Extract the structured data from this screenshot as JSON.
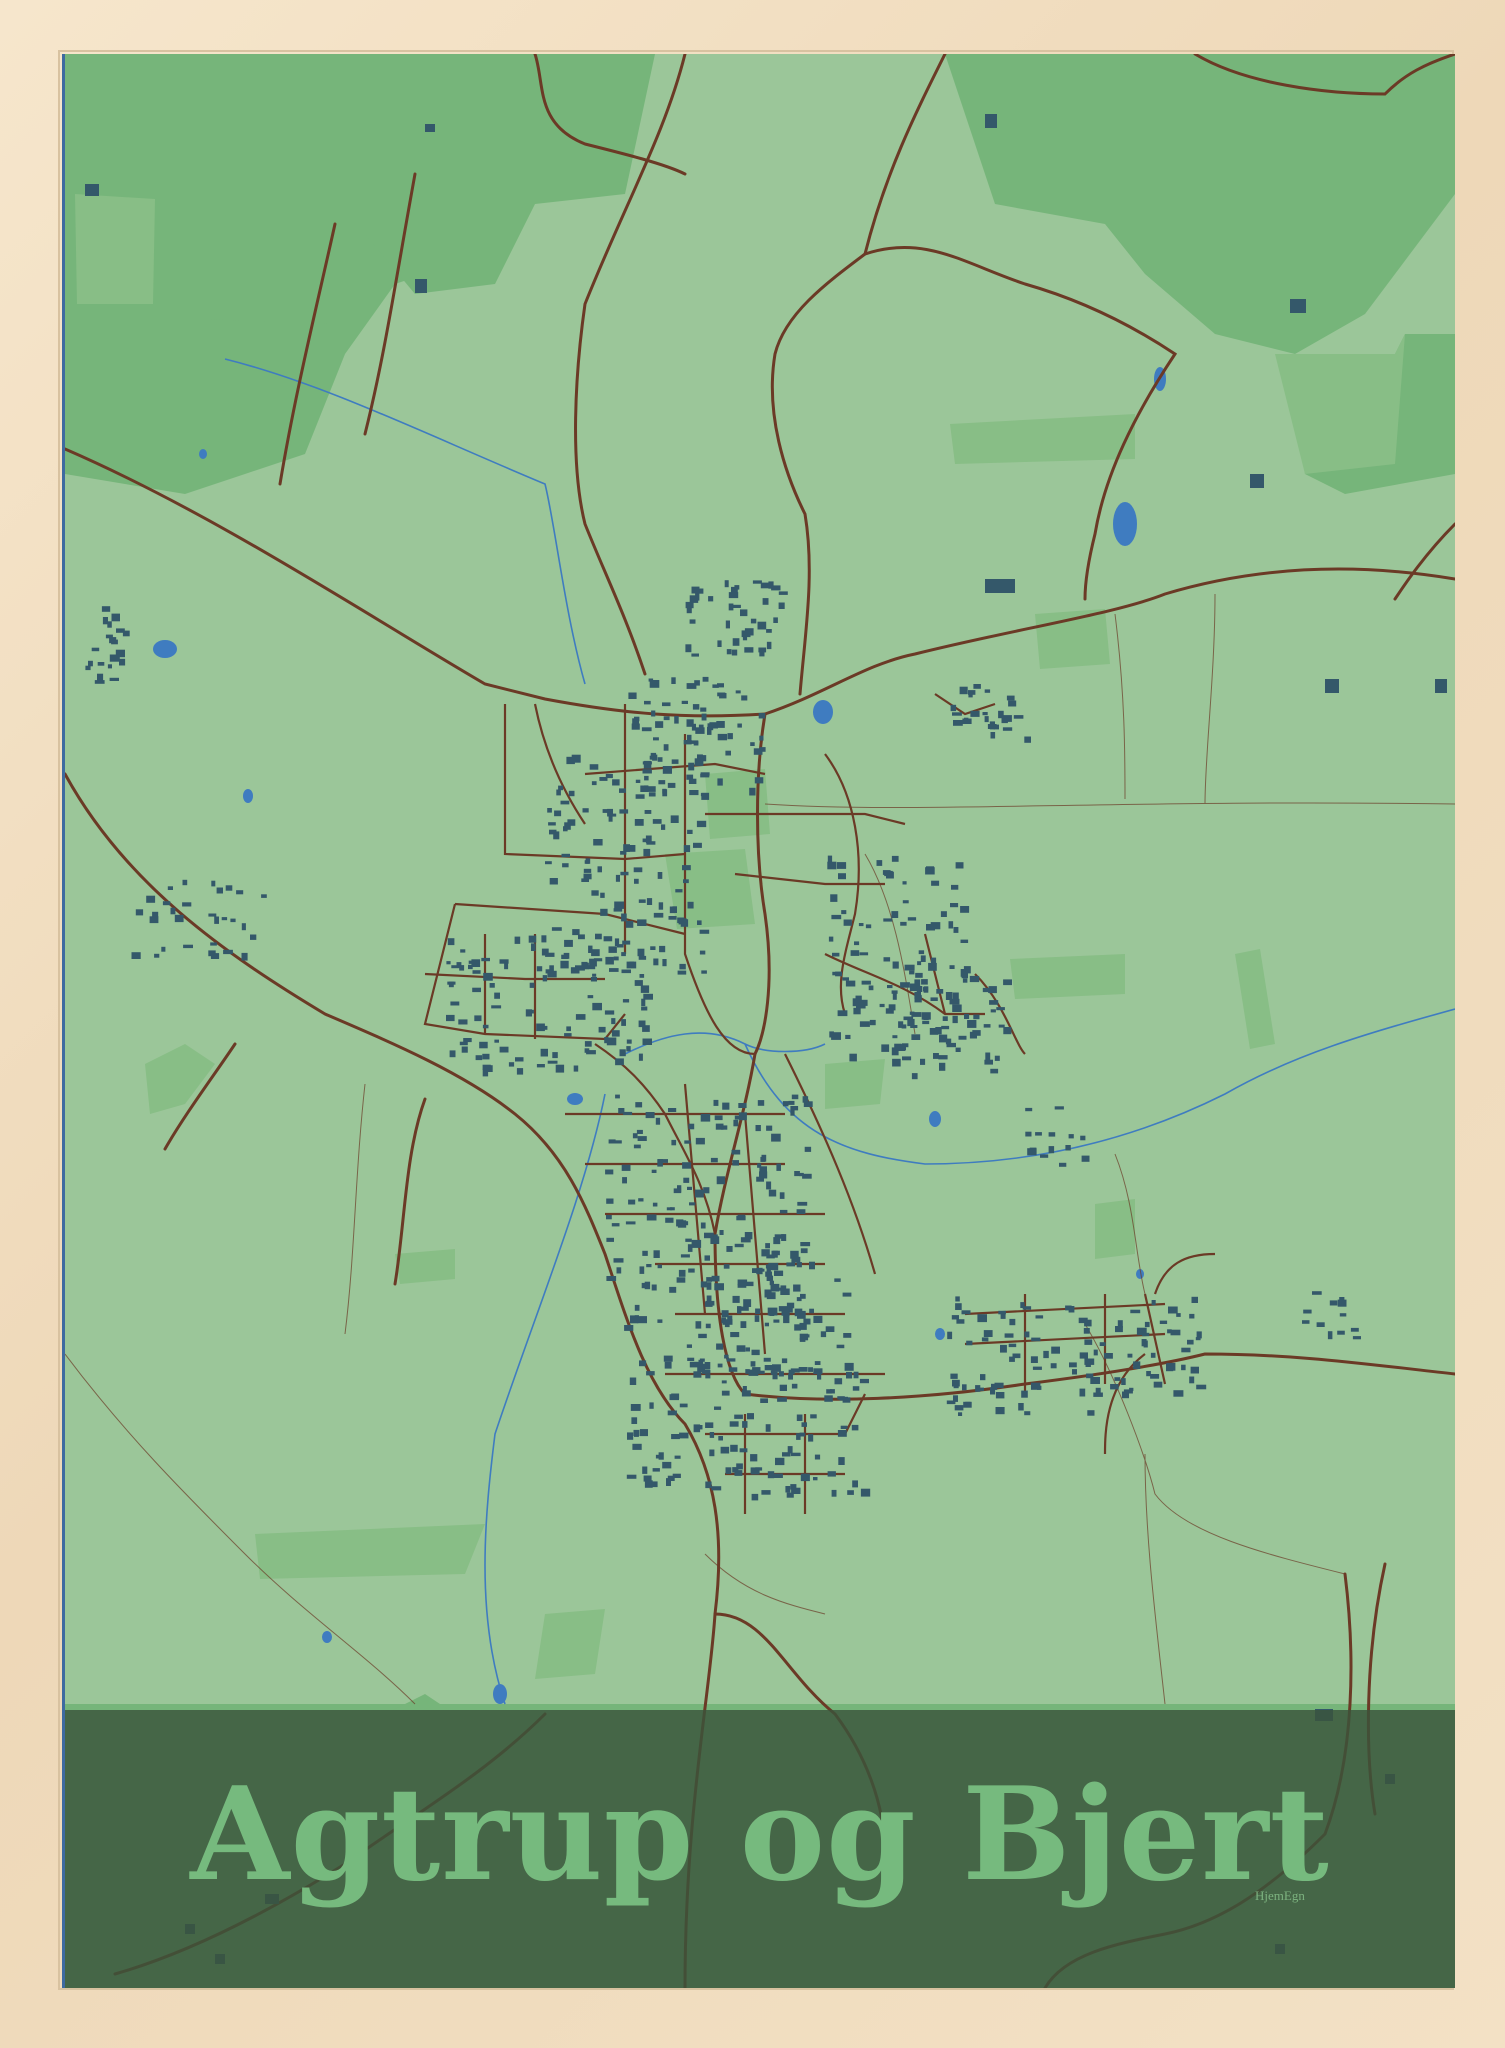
{
  "poster": {
    "title": "Agtrup og Bjert",
    "brand": "HjemEgn"
  },
  "colors": {
    "frame": "#f3e1c5",
    "base_land": "#9bc699",
    "field_dark": "#76b57a",
    "field_mid": "#88be86",
    "roads": "#6b3a26",
    "buildings": "#34586a",
    "water": "#3f7cc0",
    "band": "#3a543c",
    "title": "#76ba7e"
  },
  "icons": {
    "frame": "wooden-frame",
    "map": "street-map"
  }
}
